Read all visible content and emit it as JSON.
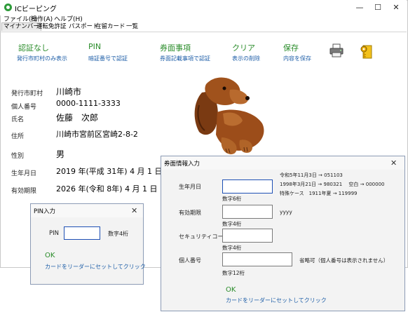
{
  "window": {
    "title": "ICビーピング",
    "controls": {
      "minimize": "—",
      "maximize": "☐",
      "close": "✕"
    }
  },
  "menu": [
    "ファイル(F)",
    "操作(A)",
    "ヘルプ(H)"
  ],
  "tabs": [
    "マイナンバー",
    "運転免許証",
    "パスポート",
    "在留カード",
    "一覧"
  ],
  "toolbar": [
    {
      "title": "認証なし",
      "sub": "発行市町村のみ表示"
    },
    {
      "title": "PIN",
      "sub": "暗証番号で認証"
    },
    {
      "title": "券面事項",
      "sub": "券面記載事項で認証"
    },
    {
      "title": "クリア",
      "sub": "表示の削除"
    },
    {
      "title": "保存",
      "sub": "内容を保存"
    }
  ],
  "fields": [
    {
      "label": "発行市町村",
      "value": "川崎市"
    },
    {
      "label": "個人番号",
      "value": "0000-1111-3333"
    },
    {
      "label": "氏名",
      "value": "佐藤　次郎"
    },
    {
      "label": "住所",
      "value": "川崎市宮前区宮崎2-8-2"
    },
    {
      "label": "性別",
      "value": "男"
    },
    {
      "label": "生年月日",
      "value": "2019 年(平成 31年) 4 月 1 日"
    },
    {
      "label": "有効期限",
      "value": "2026 年(令和 8年) 4 月 1 日"
    }
  ],
  "pin_dialog": {
    "title": "PIN入力",
    "close": "✕",
    "label": "PIN",
    "value": "",
    "hint": "数字4桁",
    "ok": "OK",
    "link": "カードをリーダーにセットしてクリック"
  },
  "card_dialog": {
    "title": "券面情報入力",
    "close": "✕",
    "notes": [
      "令和5年11月3日 → 051103",
      "1998年3月21日 → 980321　 空白 → 000000",
      "特殊ケース　1911年夏 → 119999"
    ],
    "rows": [
      {
        "label": "生年月日",
        "hint": "数字6桁",
        "suffix": ""
      },
      {
        "label": "有効期限",
        "hint": "数字4桁",
        "suffix": "yyyy"
      },
      {
        "label": "セキュリティコード",
        "hint": "数字4桁",
        "suffix": ""
      },
      {
        "label": "個人番号",
        "hint": "数字12桁",
        "suffix": "省略可（個人番号は表示されません）"
      }
    ],
    "ok": "OK",
    "link": "カードをリーダーにセットしてクリック"
  }
}
